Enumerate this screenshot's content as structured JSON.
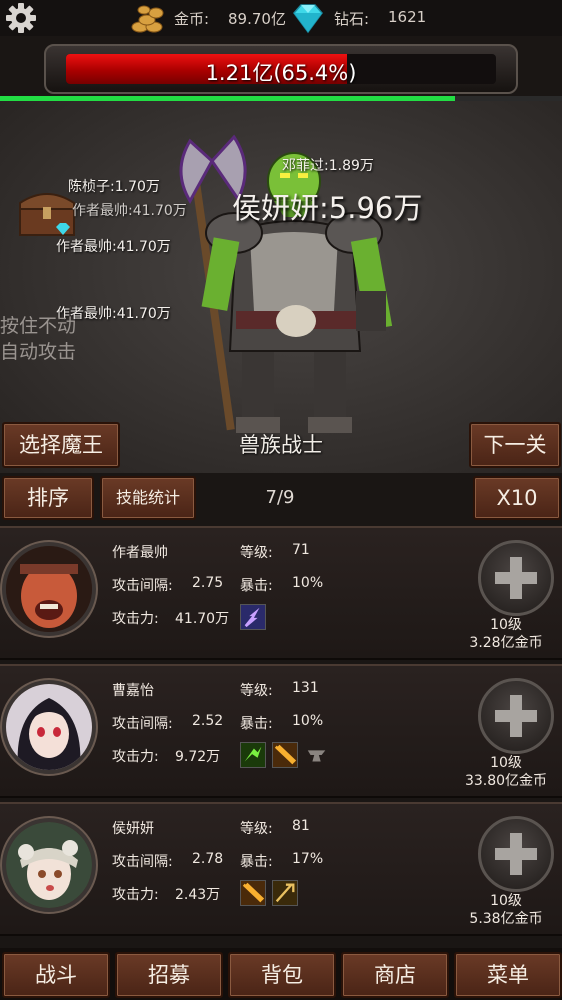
{
  "topbar": {
    "gold_label": "金币:",
    "gold_value": "89.70亿",
    "diamond_label": "钻石:",
    "diamond_value": "1621"
  },
  "boss": {
    "hp_text": "1.21亿(65.4%)",
    "hp_fraction": 0.654,
    "timer_fraction": 0.81,
    "name": "兽族战士"
  },
  "floating_damage": [
    "陈桢子:1.70万",
    "作者最帅:41.70万",
    "邓菲过:1.89万",
    "作者最帅:41.70万",
    "作者最帅:41.70万"
  ],
  "big_damage": "侯妍妍:5.96万",
  "hint": {
    "line1": "按住不动",
    "line2": "自动攻击"
  },
  "controls": {
    "select_boss": "选择魔王",
    "next_level": "下一关",
    "sort": "排序",
    "skill_stats": "技能统计",
    "page": "7/9",
    "multiplier": "X10"
  },
  "labels": {
    "level": "等级:",
    "interval": "攻击间隔:",
    "crit": "暴击:",
    "attack": "攻击力:"
  },
  "heroes": [
    {
      "name": "作者最帅",
      "level": "71",
      "interval": "2.75",
      "crit": "10%",
      "attack": "41.70万",
      "upgrade_levels": "10级",
      "upgrade_cost": "3.28亿金币",
      "skills": [
        "lightning-skill-icon"
      ]
    },
    {
      "name": "曹嘉怡",
      "level": "131",
      "interval": "2.52",
      "crit": "10%",
      "attack": "9.72万",
      "upgrade_levels": "10级",
      "upgrade_cost": "33.80亿金币",
      "skills": [
        "dash-skill-icon",
        "strike-skill-icon",
        "anvil-skill-icon"
      ]
    },
    {
      "name": "侯妍妍",
      "level": "81",
      "interval": "2.78",
      "crit": "17%",
      "attack": "2.43万",
      "upgrade_levels": "10级",
      "upgrade_cost": "5.38亿金币",
      "skills": [
        "strike-skill-icon",
        "slash-skill-icon"
      ]
    }
  ],
  "nav": {
    "battle": "战斗",
    "recruit": "招募",
    "bag": "背包",
    "shop": "商店",
    "menu": "菜单"
  },
  "colors": {
    "hp_bar": "#cc1111",
    "timer_bar": "#22dd44",
    "button": "#5a2e1c"
  }
}
